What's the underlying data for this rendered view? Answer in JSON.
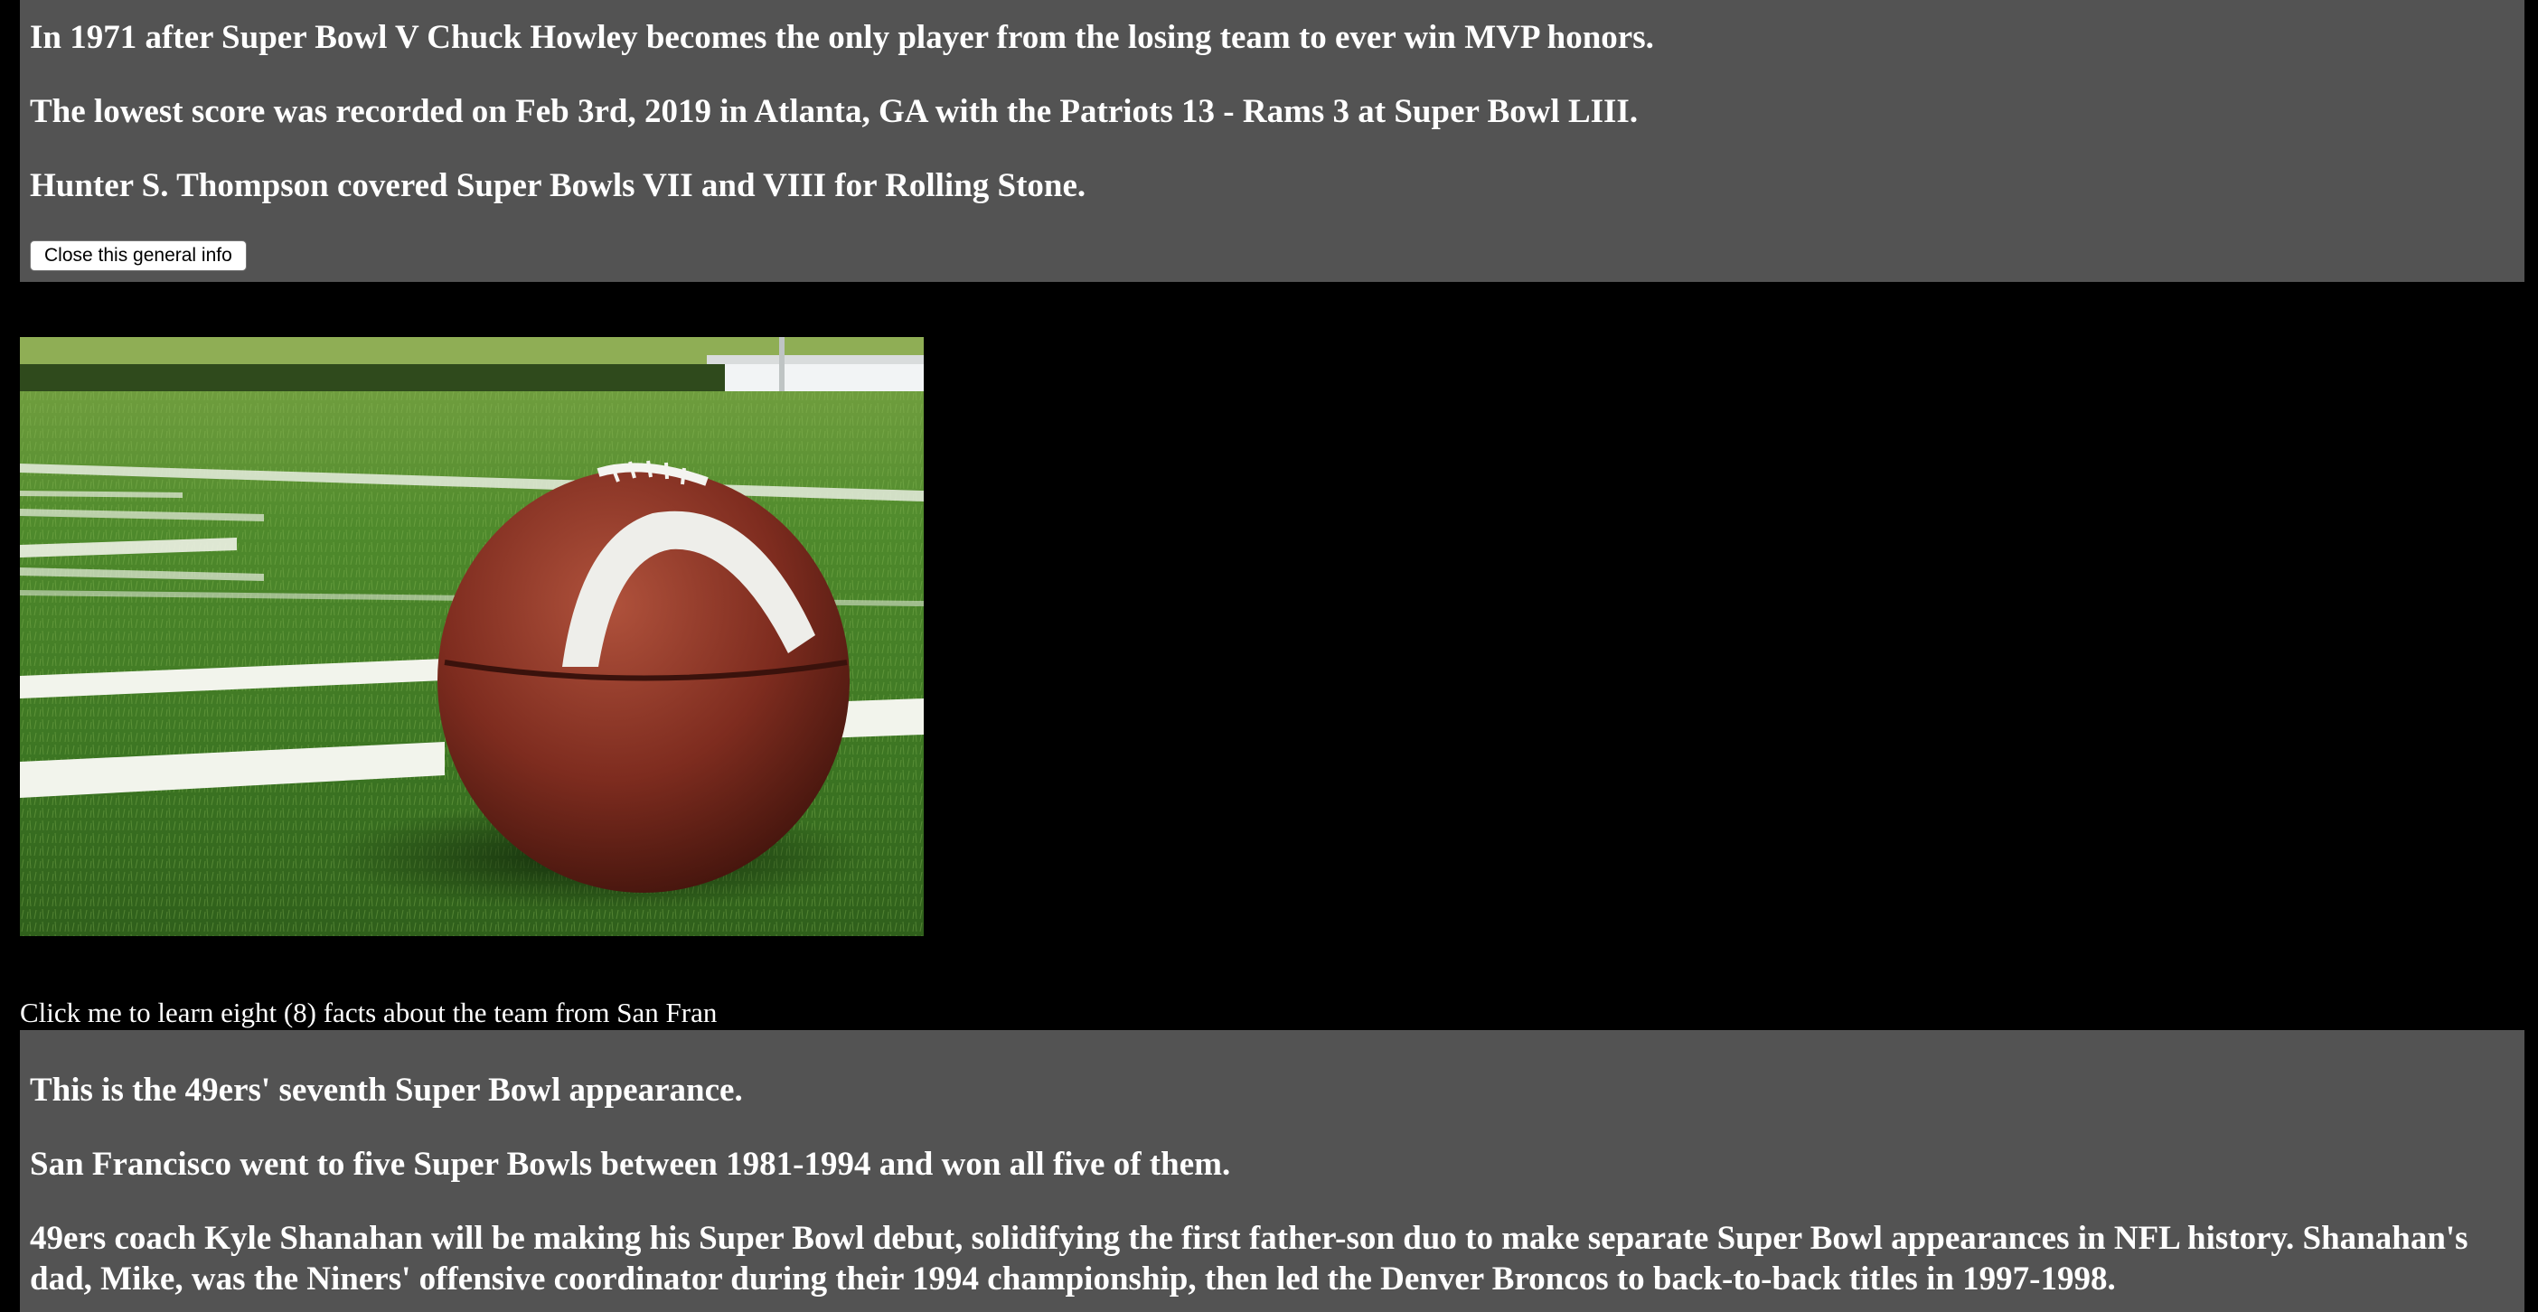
{
  "general_info": {
    "facts": [
      "In 1971 after Super Bowl V Chuck Howley becomes the only player from the losing team to ever win MVP honors.",
      "The lowest score was recorded on Feb 3rd, 2019 in Atlanta, GA with the Patriots 13 - Rams 3 at Super Bowl LIII.",
      "Hunter S. Thompson covered Super Bowls VII and VIII for Rolling Stone."
    ],
    "close_button_label": "Close this general info"
  },
  "team_section": {
    "toggle_label": "Click me to learn eight (8) facts about the team from San Fran",
    "facts": [
      "This is the 49ers' seventh Super Bowl appearance.",
      "San Francisco went to five Super Bowls between 1981-1994 and won all five of them.",
      "49ers coach Kyle Shanahan will be making his Super Bowl debut, solidifying the first father-son duo to make separate Super Bowl appearances in NFL history. Shanahan's dad, Mike, was the Niners' offensive coordinator during their 1994 championship, then led the Denver Broncos to back-to-back titles in 1997-1998."
    ]
  },
  "colors": {
    "page_background": "#000000",
    "panel_background": "#535353",
    "text": "#ffffff"
  }
}
